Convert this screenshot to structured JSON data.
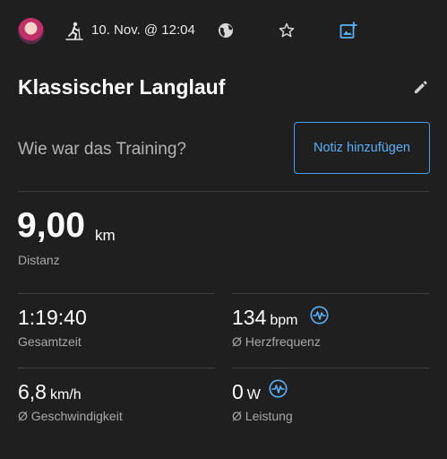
{
  "header": {
    "date": "10. Nov. @ 12:04",
    "icons": [
      "avatar",
      "cross-country-ski-icon",
      "globe-icon",
      "star-icon",
      "add-photo-icon"
    ]
  },
  "activity": {
    "title": "Klassischer Langlauf",
    "prompt": "Wie war das Training?",
    "note_button": "Notiz hinzufügen"
  },
  "distance": {
    "value": "9,00",
    "unit": "km",
    "label": "Distanz"
  },
  "stats": [
    {
      "value": "1:19:40",
      "unit": "",
      "label": "Gesamtzeit"
    },
    {
      "value": "134",
      "unit": "bpm",
      "label": "Ø Herzfrequenz"
    },
    {
      "value": "6,8",
      "unit": "km/h",
      "label": "Ø Geschwindigkeit"
    },
    {
      "value": "0",
      "unit": "W",
      "label": "Ø Leistung"
    }
  ],
  "colors": {
    "background": "#1f1f1f",
    "accent": "#4a9ee8",
    "label": "#a8a8a8"
  }
}
